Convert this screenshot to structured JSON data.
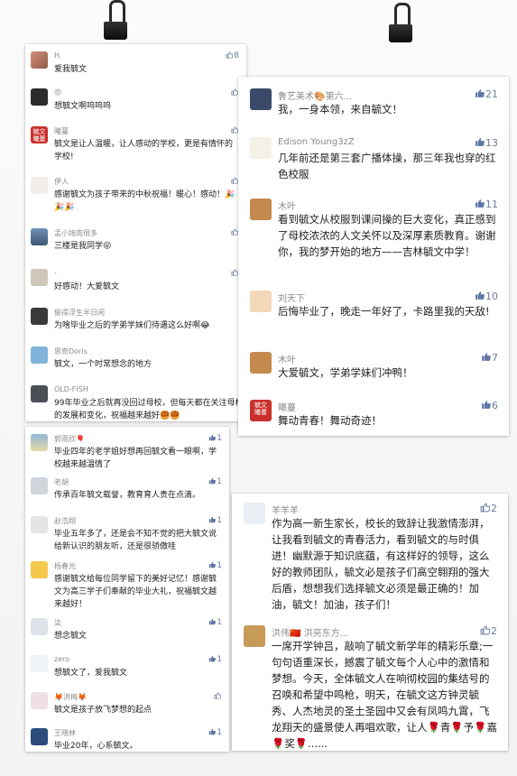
{
  "card1": {
    "comments": [
      {
        "name": "H.",
        "text": "爱我毓文",
        "likes": "8",
        "avatar": "photo-avatar"
      },
      {
        "name": "😡",
        "text": "想毓文啊呜呜呜",
        "likes": "",
        "avatar": "photo-avatar"
      },
      {
        "name": "曦蔓",
        "text": "毓文是让人温暖，让人感动的学校，更是有情怀的学校!",
        "likes": "",
        "avatar": "seal-avatar"
      },
      {
        "name": "伊人",
        "text": "感谢毓文为孩子带来的中秋祝福！暖心！感动！🎉🎉🎉",
        "likes": "",
        "avatar": "photo-avatar"
      },
      {
        "name": "孟小旭肉很多",
        "text": "三楼是我同学😝",
        "likes": "",
        "avatar": "photo-avatar"
      },
      {
        "name": "-",
        "text": "好感动！大爱毓文",
        "likes": "",
        "avatar": "photo-avatar"
      },
      {
        "name": "偷得浮生半日闲",
        "text": "为啥毕业之后的学弟学妹们待遇这么好啊😂",
        "likes": "",
        "avatar": "photo-avatar"
      },
      {
        "name": "思奇Doris",
        "text": "毓文，一个时常想念的地方",
        "likes": "",
        "avatar": "photo-avatar"
      },
      {
        "name": "OLD-FISH",
        "text": "99年毕业之后就再没回过母校，但每天都在关注母校的发展和变化，祝福越来越好🥮🥮",
        "likes": "",
        "avatar": "photo-avatar"
      }
    ]
  },
  "card2": {
    "comments": [
      {
        "name": "鲁艺美术🎨第六...",
        "text": "我，一身本领，来自毓文！",
        "likes": "21",
        "avatar": "photo-avatar"
      },
      {
        "name": "Edison Young3zZ",
        "text": "几年前还是第三套广播体操，那三年我也穿的红色校服",
        "likes": "13",
        "avatar": "photo-avatar"
      },
      {
        "name": "木叶",
        "text": "看到毓文从校服到课间操的巨大变化，真正感到了母校浓浓的人文关怀以及深厚素质教育。谢谢你，我的梦开始的地方——吉林毓文中学！",
        "likes": "11",
        "avatar": "dog-avatar"
      },
      {
        "name": "刘天下",
        "text": "后悔毕业了，晚走一年好了，卡路里我的天敌!",
        "likes": "10",
        "avatar": "photo-avatar"
      },
      {
        "name": "木叶",
        "text": "大爱毓文，学弟学妹们冲鸭！",
        "likes": "7",
        "avatar": "dog-avatar"
      },
      {
        "name": "曦蔓",
        "text": "舞动青春！舞动奇迹！",
        "likes": "6",
        "avatar": "seal-avatar"
      }
    ]
  },
  "card3": {
    "comments": [
      {
        "name": "郭雨欣🎈",
        "text": "毕业四年的老学姐好想再回毓文看一眼啊，学校越来越温情了",
        "likes": "1",
        "avatar": "photo-avatar"
      },
      {
        "name": "老胡",
        "text": "传承百年毓文载誉，教育育人贵在点滴。",
        "likes": "1",
        "avatar": "photo-avatar"
      },
      {
        "name": "赵浩翔",
        "text": "毕业五年多了，还是会不知不觉的把大毓文说给新认识的朋友听，还是很骄傲哇",
        "likes": "1",
        "avatar": "photo-avatar"
      },
      {
        "name": "杨春光",
        "text": "感谢毓文给每位同学留下的美好记忆！感谢毓文为高三学子们奉献的毕业大礼，祝福毓文越来越好！",
        "likes": "1",
        "avatar": "photo-avatar"
      },
      {
        "name": "柒",
        "text": "想念毓文",
        "likes": "1",
        "avatar": "photo-avatar"
      },
      {
        "name": "zero",
        "text": "想毓文了，爱我毓文",
        "likes": "1",
        "avatar": "photo-avatar"
      },
      {
        "name": "🦊洪梅🦊",
        "text": "毓文是孩子放飞梦想的起点",
        "likes": "",
        "avatar": "photo-avatar"
      },
      {
        "name": "王晓林",
        "text": "毕业20年，心系毓文。",
        "likes": "1",
        "avatar": "photo-avatar"
      }
    ]
  },
  "card4": {
    "comments": [
      {
        "name": "羊羊羊",
        "text": "作为高一新生家长，校长的致辞让我激情澎湃，让我看到毓文的青春活力，看到毓文的与时俱进！幽默源于知识底蕴，有这样好的领导，这么好的教师团队，毓文必是孩子们高空翱翔的强大后盾，想想我们选择毓文必须是最正确的！加油，毓文！加油，孩子们！",
        "likes": "2",
        "avatar": "photo-avatar"
      },
      {
        "name": "洪伟🇨🇳 洪亮东方...",
        "text": "一席开学钟吕，敲响了毓文新学年的精彩乐章;一句句语重深长，撼震了毓文每个人心中的激情和梦想。今天，全体毓文人在响彻校园的集结号的召唤和希望中鸣枪，明天，在毓文这方钟灵毓秀、人杰地灵的圣土圣园中又会有凤鸣九霄，飞龙翔天的盛景使人再唱欢歌，让人🌹青🌹予🌹嘉🌹奖🌹......",
        "likes": "2",
        "avatar": "photo-avatar"
      }
    ]
  },
  "colors": {
    "like": "#6a7c9e",
    "seal": "#c9302c"
  }
}
